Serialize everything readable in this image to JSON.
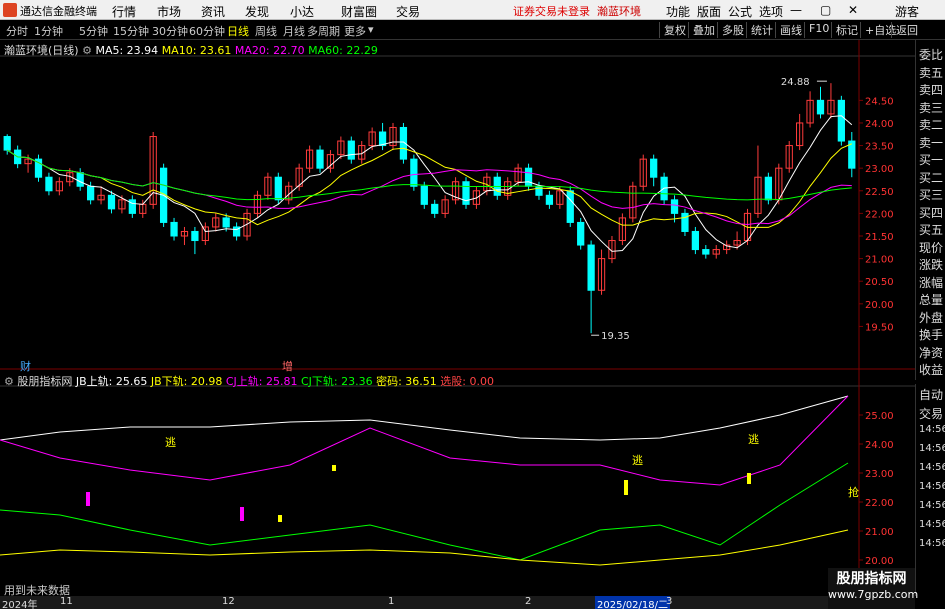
{
  "app": {
    "title": "通达信金融终端"
  },
  "menu": [
    "行情",
    "市场",
    "资讯",
    "发现",
    "小达",
    "财富圈",
    "交易"
  ],
  "menu_right": [
    "功能",
    "版面",
    "公式",
    "选项",
    "游客"
  ],
  "login_status": "证券交易未登录",
  "stock_name_top": "瀚蓝环境",
  "periods": [
    "分时",
    "1分钟",
    "5分钟",
    "15分钟",
    "30分钟",
    "60分钟",
    "日线",
    "周线",
    "月线",
    "多周期",
    "更多"
  ],
  "active_period": "日线",
  "tools": [
    "复权",
    "叠加",
    "多股",
    "统计",
    "画线",
    "F10",
    "标记",
    "+自选",
    "返回"
  ],
  "main_legend": {
    "name": "瀚蓝环境(日线)",
    "ma5": "MA5: 23.94",
    "ma10": "MA10: 23.61",
    "ma20": "MA20: 22.70",
    "ma60": "MA60: 22.29"
  },
  "price_axis": [
    "24.50",
    "24.00",
    "23.50",
    "23.00",
    "22.50",
    "22.00",
    "21.50",
    "21.00",
    "20.50",
    "20.00",
    "19.50"
  ],
  "high_label": "24.88",
  "low_label": "19.35",
  "markers": {
    "cai": "财",
    "zeng": "增"
  },
  "ind_legend": {
    "name": "股朋指标网",
    "jbup": "JB上轨: 25.65",
    "jbdn": "JB下轨: 20.98",
    "cjup": "CJ上轨: 25.81",
    "cjdn": "CJ下轨: 23.36",
    "mima": "密码: 36.51",
    "xuangu": "选股: 0.00"
  },
  "ind_axis": [
    "25.00",
    "24.00",
    "23.00",
    "22.00",
    "21.00",
    "20.00"
  ],
  "ind_texts": {
    "tao": "逃",
    "qiang": "抢"
  },
  "bottom_note": "用到未来数据",
  "right_panel_top": [
    "委比",
    "卖五",
    "卖四",
    "卖三",
    "卖二",
    "卖一",
    "买一",
    "买二",
    "买三",
    "买四",
    "买五",
    "现价",
    "涨跌",
    "涨幅",
    "总量",
    "外盘",
    "换手",
    "净资",
    "收益"
  ],
  "right_panel_bottom": [
    "自动",
    "交易",
    "14:56",
    "14:56",
    "14:56",
    "14:56",
    "14:56",
    "14:56",
    "14:56"
  ],
  "dates": [
    "2024年",
    "11",
    "12",
    "1",
    "2",
    "2025/02/18/二",
    "3"
  ],
  "watermark": {
    "line1": "股朋指标网",
    "line2": "www.7gpzb.com"
  },
  "colors": {
    "up": "#ff3c3c",
    "down": "#00ffff",
    "ma5": "#ffffff",
    "ma10": "#ffff00",
    "ma20": "#ff00ff",
    "ma60": "#00ff00",
    "grid": "#7a0000"
  },
  "chart_data": {
    "type": "candlestick",
    "ylim": [
      19.2,
      24.95
    ],
    "candles": [
      [
        23.7,
        23.4,
        23.75,
        23.3
      ],
      [
        23.4,
        23.1,
        23.5,
        23.0
      ],
      [
        23.1,
        23.2,
        23.3,
        22.9
      ],
      [
        23.2,
        22.8,
        23.3,
        22.7
      ],
      [
        22.8,
        22.5,
        22.9,
        22.4
      ],
      [
        22.5,
        22.7,
        22.8,
        22.4
      ],
      [
        22.7,
        22.9,
        23.0,
        22.6
      ],
      [
        22.9,
        22.6,
        23.0,
        22.5
      ],
      [
        22.6,
        22.3,
        22.7,
        22.2
      ],
      [
        22.3,
        22.4,
        22.6,
        22.2
      ],
      [
        22.4,
        22.1,
        22.5,
        22.0
      ],
      [
        22.1,
        22.3,
        22.4,
        22.0
      ],
      [
        22.3,
        22.0,
        22.4,
        21.9
      ],
      [
        22.0,
        22.2,
        22.3,
        21.9
      ],
      [
        22.2,
        23.7,
        23.8,
        22.1
      ],
      [
        23.0,
        21.8,
        23.1,
        21.7
      ],
      [
        21.8,
        21.5,
        21.9,
        21.4
      ],
      [
        21.5,
        21.6,
        21.7,
        21.3
      ],
      [
        21.6,
        21.4,
        21.7,
        21.1
      ],
      [
        21.4,
        21.7,
        21.8,
        21.3
      ],
      [
        21.7,
        21.9,
        22.0,
        21.6
      ],
      [
        21.9,
        21.7,
        22.0,
        21.6
      ],
      [
        21.7,
        21.5,
        21.8,
        21.4
      ],
      [
        21.5,
        22.0,
        22.1,
        21.4
      ],
      [
        22.0,
        22.4,
        22.5,
        21.9
      ],
      [
        22.4,
        22.8,
        22.9,
        22.3
      ],
      [
        22.8,
        22.3,
        22.9,
        22.2
      ],
      [
        22.3,
        22.6,
        22.7,
        22.2
      ],
      [
        22.6,
        23.0,
        23.1,
        22.5
      ],
      [
        23.0,
        23.4,
        23.5,
        22.9
      ],
      [
        23.4,
        23.0,
        23.5,
        22.9
      ],
      [
        23.0,
        23.3,
        23.4,
        22.9
      ],
      [
        23.3,
        23.6,
        23.7,
        23.2
      ],
      [
        23.6,
        23.2,
        23.7,
        23.1
      ],
      [
        23.2,
        23.5,
        23.6,
        23.1
      ],
      [
        23.5,
        23.8,
        23.9,
        23.4
      ],
      [
        23.8,
        23.5,
        24.0,
        23.4
      ],
      [
        23.5,
        23.9,
        24.0,
        23.4
      ],
      [
        23.9,
        23.2,
        24.0,
        23.1
      ],
      [
        23.2,
        22.6,
        23.3,
        22.5
      ],
      [
        22.6,
        22.2,
        22.7,
        22.1
      ],
      [
        22.2,
        22.0,
        22.3,
        21.9
      ],
      [
        22.0,
        22.3,
        22.4,
        21.9
      ],
      [
        22.3,
        22.7,
        22.8,
        22.2
      ],
      [
        22.7,
        22.2,
        22.8,
        22.1
      ],
      [
        22.2,
        22.5,
        22.6,
        22.1
      ],
      [
        22.5,
        22.8,
        22.9,
        22.4
      ],
      [
        22.8,
        22.4,
        22.9,
        22.3
      ],
      [
        22.4,
        22.7,
        22.8,
        22.3
      ],
      [
        22.7,
        23.0,
        23.1,
        22.6
      ],
      [
        23.0,
        22.6,
        23.1,
        22.5
      ],
      [
        22.6,
        22.4,
        22.7,
        22.3
      ],
      [
        22.4,
        22.2,
        22.5,
        22.1
      ],
      [
        22.2,
        22.5,
        22.6,
        22.1
      ],
      [
        22.5,
        21.8,
        22.6,
        21.7
      ],
      [
        21.8,
        21.3,
        21.9,
        21.2
      ],
      [
        21.3,
        20.3,
        21.4,
        19.35
      ],
      [
        20.3,
        21.0,
        21.2,
        20.2
      ],
      [
        21.0,
        21.4,
        21.5,
        20.9
      ],
      [
        21.4,
        21.9,
        22.0,
        21.3
      ],
      [
        21.9,
        22.6,
        22.7,
        21.8
      ],
      [
        22.6,
        23.2,
        23.3,
        22.5
      ],
      [
        23.2,
        22.8,
        23.3,
        22.6
      ],
      [
        22.8,
        22.3,
        22.9,
        22.2
      ],
      [
        22.3,
        22.0,
        22.4,
        21.8
      ],
      [
        22.0,
        21.6,
        22.1,
        21.5
      ],
      [
        21.6,
        21.2,
        21.7,
        21.1
      ],
      [
        21.2,
        21.1,
        21.3,
        21.0
      ],
      [
        21.1,
        21.2,
        21.3,
        21.0
      ],
      [
        21.2,
        21.3,
        21.4,
        21.1
      ],
      [
        21.3,
        21.4,
        21.6,
        21.2
      ],
      [
        21.4,
        22.0,
        22.1,
        21.3
      ],
      [
        22.0,
        22.8,
        23.5,
        21.9
      ],
      [
        22.8,
        22.3,
        22.9,
        22.2
      ],
      [
        22.3,
        23.0,
        23.1,
        22.2
      ],
      [
        23.0,
        23.5,
        23.6,
        22.9
      ],
      [
        23.5,
        24.0,
        24.2,
        23.4
      ],
      [
        24.0,
        24.5,
        24.7,
        23.9
      ],
      [
        24.5,
        24.2,
        24.8,
        24.1
      ],
      [
        24.2,
        24.5,
        24.88,
        24.1
      ],
      [
        24.5,
        23.6,
        24.6,
        23.5
      ],
      [
        23.6,
        23.0,
        23.8,
        22.8
      ]
    ]
  }
}
